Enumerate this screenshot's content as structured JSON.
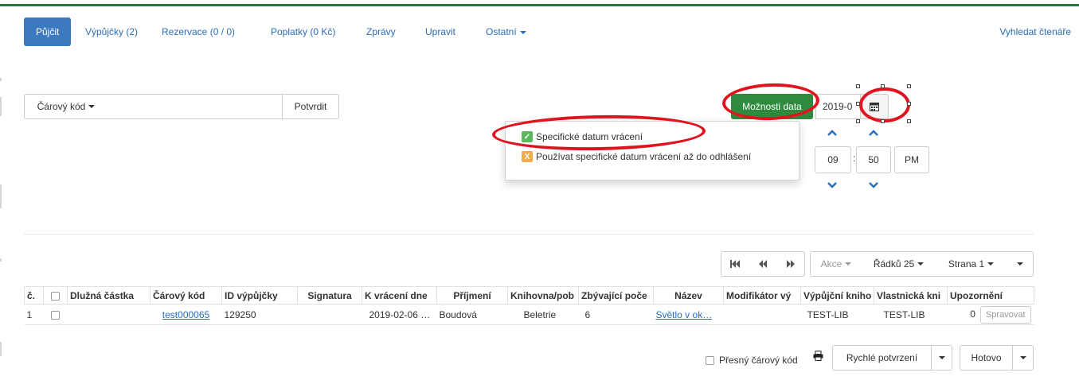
{
  "colors": {
    "accent": "#3b7ac0",
    "link": "#2a6ebb",
    "success": "#2e8b3e",
    "warning": "#f0ad4e",
    "annotation": "#e0141e"
  },
  "nav": {
    "tabs": [
      {
        "label": "Půjčit"
      },
      {
        "label": "Výpůjčky (2)"
      },
      {
        "label": "Rezervace (0 / 0)"
      },
      {
        "label": "Poplatky (0 Kč)"
      },
      {
        "label": "Zprávy"
      },
      {
        "label": "Upravit"
      },
      {
        "label": "Ostatní"
      }
    ],
    "search_patron": "Vyhledat čtenáře"
  },
  "checkout": {
    "barcode_type": "Čárový kód",
    "barcode_value": "",
    "submit": "Potvrdit"
  },
  "date_options": {
    "button": "Možnosti data",
    "date_value": "2019-0",
    "calendar_icon": "calendar-icon",
    "menu": [
      {
        "mark": "✓",
        "label": "Specifické datum vrácení"
      },
      {
        "mark": "X",
        "label": "Používat specifické datum vrácení až do odhlášení"
      }
    ],
    "time": {
      "hour": "09",
      "separator": ":",
      "minute": "50",
      "ampm": "PM"
    }
  },
  "grid_controls": {
    "first_icon": "first-page-icon",
    "prev_icon": "previous-page-icon",
    "next_icon": "next-page-icon",
    "actions": "Akce",
    "rows": "Řádků 25",
    "page": "Strana 1"
  },
  "table": {
    "headers": [
      "č.",
      "",
      "Dlužná částka",
      "Čárový kód",
      "ID výpůjčky",
      "Signatura",
      "K vrácení dne",
      "Příjmení",
      "Knihovna/pob",
      "Zbývající poče",
      "Název",
      "Modifikátor vý",
      "Výpůjční kniho",
      "Vlastnická kni",
      "Upozornění"
    ],
    "rows": [
      {
        "num": "1",
        "owed": "",
        "barcode": "test000065",
        "circ_id": "129250",
        "call_number": "",
        "due_date": "2019-02-06 …",
        "surname": "Boudová",
        "library": "Beletrie",
        "remaining": "6",
        "title": "Světlo v ok…",
        "modifier": "",
        "circ_lib": "TEST-LIB",
        "owning_lib": "TEST-LIB",
        "alerts_count": "0",
        "manage": "Spravovat"
      }
    ]
  },
  "footer": {
    "exact_barcode": "Přesný čárový kód",
    "print_icon": "print-icon",
    "quick_receipt": "Rychlé potvrzení",
    "done": "Hotovo"
  }
}
